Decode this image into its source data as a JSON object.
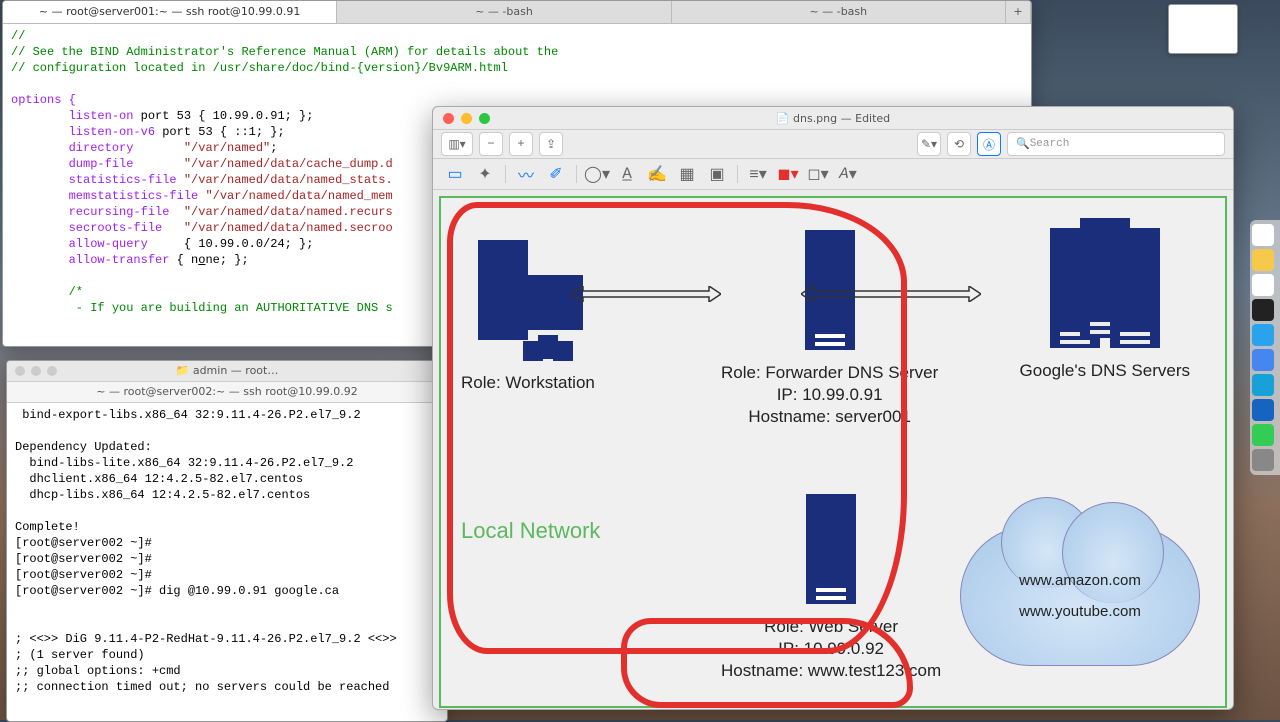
{
  "term1": {
    "tabs": [
      "~ — root@server001:~ — ssh root@10.99.0.91",
      "~ — -bash",
      "~ — -bash"
    ],
    "lines": [
      {
        "t": "//",
        "c": "green"
      },
      {
        "t": "// See the BIND Administrator's Reference Manual (ARM) for details about the",
        "c": "green"
      },
      {
        "t": "// configuration located in /usr/share/doc/bind-{version}/Bv9ARM.html",
        "c": "green"
      },
      {
        "t": ""
      },
      {
        "t": "options {",
        "c": "kw"
      },
      {
        "t": "        listen-on port 53 { 10.99.0.91; };",
        "mix": [
          [
            "        ",
            ""
          ],
          [
            "listen-on",
            "kw"
          ],
          [
            " port 53 { 10.99.0.91; };",
            ""
          ]
        ]
      },
      {
        "t": "        listen-on-v6 port 53 { ::1; };",
        "mix": [
          [
            "        ",
            ""
          ],
          [
            "listen-on-v6",
            "kw"
          ],
          [
            " port 53 { ::1; };",
            ""
          ]
        ]
      },
      {
        "t": "        directory       \"/var/named\";",
        "mix": [
          [
            "        ",
            ""
          ],
          [
            "directory",
            "kw"
          ],
          [
            "       ",
            ""
          ],
          [
            "\"/var/named\"",
            "str"
          ],
          [
            ";",
            ""
          ]
        ]
      },
      {
        "t": "        dump-file       \"/var/named/data/cache_dump.d",
        "mix": [
          [
            "        ",
            ""
          ],
          [
            "dump-file",
            "kw"
          ],
          [
            "       ",
            ""
          ],
          [
            "\"/var/named/data/cache_dump.d",
            "str"
          ]
        ]
      },
      {
        "t": "        statistics-file \"/var/named/data/named_stats.",
        "mix": [
          [
            "        ",
            ""
          ],
          [
            "statistics-file",
            "kw"
          ],
          [
            " ",
            ""
          ],
          [
            "\"/var/named/data/named_stats.",
            "str"
          ]
        ]
      },
      {
        "t": "        memstatistics-file \"/var/named/data/named_mem",
        "mix": [
          [
            "        ",
            ""
          ],
          [
            "memstatistics-file",
            "kw"
          ],
          [
            " ",
            ""
          ],
          [
            "\"/var/named/data/named_mem",
            "str"
          ]
        ]
      },
      {
        "t": "        recursing-file  \"/var/named/data/named.recurs",
        "mix": [
          [
            "        ",
            ""
          ],
          [
            "recursing-file",
            "kw"
          ],
          [
            "  ",
            ""
          ],
          [
            "\"/var/named/data/named.recurs",
            "str"
          ]
        ]
      },
      {
        "t": "        secroots-file   \"/var/named/data/named.secroo",
        "mix": [
          [
            "        ",
            ""
          ],
          [
            "secroots-file",
            "kw"
          ],
          [
            "   ",
            ""
          ],
          [
            "\"/var/named/data/named.secroo",
            "str"
          ]
        ]
      },
      {
        "t": "        allow-query     { 10.99.0.0/24; };",
        "mix": [
          [
            "        ",
            ""
          ],
          [
            "allow-query",
            "kw"
          ],
          [
            "     { 10.99.0.0/24; };",
            ""
          ]
        ]
      },
      {
        "t": "        allow-transfer { none; };",
        "mix": [
          [
            "        ",
            ""
          ],
          [
            "allow-transfer",
            "kw"
          ],
          [
            " { n",
            ""
          ],
          [
            "o",
            "u"
          ],
          [
            "ne; };",
            ""
          ]
        ]
      },
      {
        "t": ""
      },
      {
        "t": "        /*",
        "c": "green"
      },
      {
        "t": "         - If you are building an AUTHORITATIVE DNS s",
        "c": "green"
      }
    ]
  },
  "term2": {
    "breadcrumb": "📁 admin — root…",
    "title": "~ — root@server002:~ — ssh root@10.99.0.92",
    "body": " bind-export-libs.x86_64 32:9.11.4-26.P2.el7_9.2\n\nDependency Updated:\n  bind-libs-lite.x86_64 32:9.11.4-26.P2.el7_9.2\n  dhclient.x86_64 12:4.2.5-82.el7.centos\n  dhcp-libs.x86_64 12:4.2.5-82.el7.centos\n\nComplete!\n[root@server002 ~]#\n[root@server002 ~]#\n[root@server002 ~]#\n[root@server002 ~]# dig @10.99.0.91 google.ca\n\n\n; <<>> DiG 9.11.4-P2-RedHat-9.11.4-26.P2.el7_9.2 <<>>\n; (1 server found)\n;; global options: +cmd\n;; connection timed out; no servers could be reached"
  },
  "preview": {
    "title": "📄 dns.png — Edited",
    "search_ph": "Search",
    "ws": {
      "role": "Role: Workstation"
    },
    "s1": {
      "role": "Role: Forwarder DNS Server",
      "ip": "IP: 10.99.0.91",
      "host": "Hostname: server001"
    },
    "s2": {
      "role": "Role: Web Server",
      "ip": "IP: 10.99.0.92",
      "host": "Hostname: www.test123.com"
    },
    "google": "Google's DNS Servers",
    "local": "Local Network",
    "cloud": {
      "a": "www.amazon.com",
      "b": "www.youtube.com"
    }
  }
}
